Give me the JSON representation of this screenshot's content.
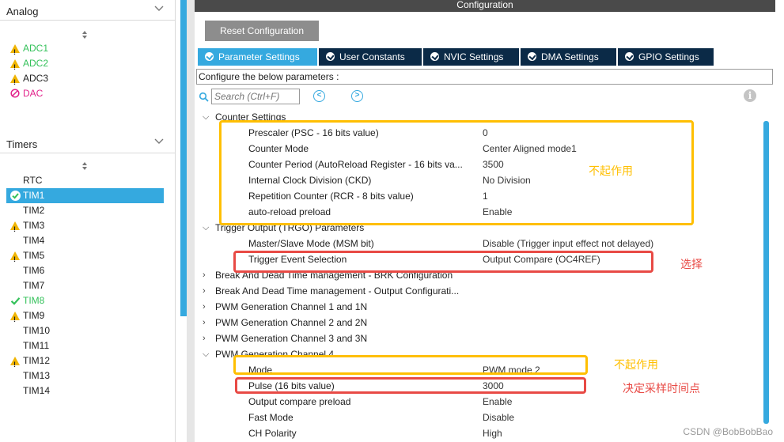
{
  "left_panel": {
    "analog": {
      "title": "Analog",
      "items": [
        {
          "label": "ADC1",
          "status": "warning",
          "color": "green"
        },
        {
          "label": "ADC2",
          "status": "warning",
          "color": "green"
        },
        {
          "label": "ADC3",
          "status": "warning",
          "color": "plain"
        },
        {
          "label": "DAC",
          "status": "disabled",
          "color": "pink"
        }
      ]
    },
    "timers": {
      "title": "Timers",
      "items": [
        {
          "label": "RTC",
          "status": "none",
          "color": "plain"
        },
        {
          "label": "TIM1",
          "status": "ok-selected",
          "color": "selected"
        },
        {
          "label": "TIM2",
          "status": "none",
          "color": "plain"
        },
        {
          "label": "TIM3",
          "status": "warning",
          "color": "plain"
        },
        {
          "label": "TIM4",
          "status": "none",
          "color": "plain"
        },
        {
          "label": "TIM5",
          "status": "warning",
          "color": "plain"
        },
        {
          "label": "TIM6",
          "status": "none",
          "color": "plain"
        },
        {
          "label": "TIM7",
          "status": "none",
          "color": "plain"
        },
        {
          "label": "TIM8",
          "status": "ok",
          "color": "green"
        },
        {
          "label": "TIM9",
          "status": "warning",
          "color": "plain"
        },
        {
          "label": "TIM10",
          "status": "none",
          "color": "plain"
        },
        {
          "label": "TIM11",
          "status": "none",
          "color": "plain"
        },
        {
          "label": "TIM12",
          "status": "warning",
          "color": "plain"
        },
        {
          "label": "TIM13",
          "status": "none",
          "color": "plain"
        },
        {
          "label": "TIM14",
          "status": "none",
          "color": "plain"
        }
      ]
    }
  },
  "config": {
    "title": "Configuration",
    "reset_button": "Reset Configuration",
    "tabs": [
      "Parameter Settings",
      "User Constants",
      "NVIC Settings",
      "DMA Settings",
      "GPIO Settings"
    ],
    "active_tab": "Parameter Settings",
    "description": "Configure the below parameters :",
    "search_placeholder": "Search (Ctrl+F)",
    "nav_prev": "<",
    "nav_next": ">",
    "info": "i"
  },
  "tree": [
    {
      "kind": "group",
      "expanded": true,
      "label": "Counter Settings"
    },
    {
      "kind": "param",
      "label": "Prescaler (PSC - 16 bits value)",
      "value": "0"
    },
    {
      "kind": "param",
      "label": "Counter Mode",
      "value": "Center Aligned mode1"
    },
    {
      "kind": "param",
      "label": "Counter Period (AutoReload Register - 16 bits va...",
      "value": "3500"
    },
    {
      "kind": "param",
      "label": "Internal Clock Division (CKD)",
      "value": "No Division"
    },
    {
      "kind": "param",
      "label": "Repetition Counter (RCR - 8 bits value)",
      "value": "1"
    },
    {
      "kind": "param",
      "label": "auto-reload preload",
      "value": "Enable"
    },
    {
      "kind": "group",
      "expanded": true,
      "label": "Trigger Output (TRGO) Parameters"
    },
    {
      "kind": "param",
      "label": "Master/Slave Mode (MSM bit)",
      "value": "Disable (Trigger input effect not delayed)"
    },
    {
      "kind": "param",
      "label": "Trigger Event Selection",
      "value": "Output Compare (OC4REF)"
    },
    {
      "kind": "group",
      "expanded": false,
      "label": "Break And Dead Time management - BRK Configuration"
    },
    {
      "kind": "group",
      "expanded": false,
      "label": "Break And Dead Time management - Output Configurati..."
    },
    {
      "kind": "group",
      "expanded": false,
      "label": "PWM Generation Channel 1 and 1N"
    },
    {
      "kind": "group",
      "expanded": false,
      "label": "PWM Generation Channel 2 and 2N"
    },
    {
      "kind": "group",
      "expanded": false,
      "label": "PWM Generation Channel 3 and 3N"
    },
    {
      "kind": "group",
      "expanded": true,
      "label": "PWM Generation Channel 4"
    },
    {
      "kind": "param",
      "label": "Mode",
      "value": "PWM mode 2"
    },
    {
      "kind": "param",
      "label": "Pulse (16 bits value)",
      "value": "3000"
    },
    {
      "kind": "param",
      "label": "Output compare preload",
      "value": "Enable"
    },
    {
      "kind": "param",
      "label": "Fast Mode",
      "value": "Disable"
    },
    {
      "kind": "param",
      "label": "CH Polarity",
      "value": "High"
    }
  ],
  "annotations": {
    "counter_note": "不起作用",
    "trigger_note": "选择",
    "mode_note": "不起作用",
    "pulse_note": "决定采样时间点"
  },
  "watermark": "CSDN @BobBobBao",
  "colors": {
    "accent": "#35a9df",
    "tab_dark": "#0b2a47",
    "warning": "#f0b400",
    "ok_green": "#34c15a",
    "disabled_pink": "#e2218a",
    "annotation_yellow": "#ffbf00",
    "annotation_red": "#e84a45"
  }
}
